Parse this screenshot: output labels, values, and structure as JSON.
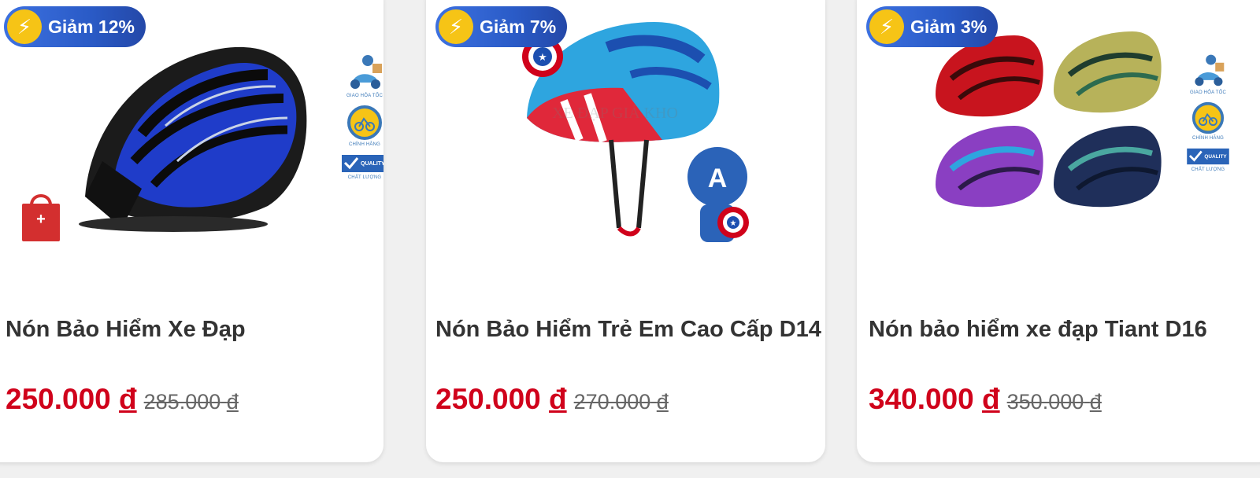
{
  "colors": {
    "badge_start": "#3d71e0",
    "badge_end": "#2448a8",
    "bolt": "#f6c416",
    "price": "#d0021b",
    "old_price": "#666666",
    "title": "#333333",
    "cart": "#d32f2f"
  },
  "products": [
    {
      "badge": "Giảm 12%",
      "title": "Nón Bảo Hiểm Xe Đạp",
      "price": "250.000",
      "old_price": "285.000",
      "currency": "đ",
      "image": "blue-black-bike-helmet",
      "services": [
        "GIAO HỎA TỐC",
        "CHÍNH HÃNG",
        "CHẤT LƯỢNG"
      ]
    },
    {
      "badge": "Giảm 7%",
      "title": "Nón Bảo Hiểm Trẻ Em Cao Cấp D14",
      "price": "250.000",
      "old_price": "270.000",
      "currency": "đ",
      "image": "captain-america-kids-helmet",
      "watermark": "XE ĐẠP GIÁ KHO"
    },
    {
      "badge": "Giảm 3%",
      "title": "Nón bảo hiểm xe đạp Tiant D16",
      "price": "340.000",
      "old_price": "350.000",
      "currency": "đ",
      "image": "four-color-helmets",
      "services": [
        "GIAO HỎA TỐC",
        "CHÍNH HÃNG",
        "CHẤT LƯỢNG"
      ]
    }
  ],
  "icons": {
    "bolt": "⚡",
    "cart_plus": "+",
    "quality_label": "QUALITY"
  }
}
